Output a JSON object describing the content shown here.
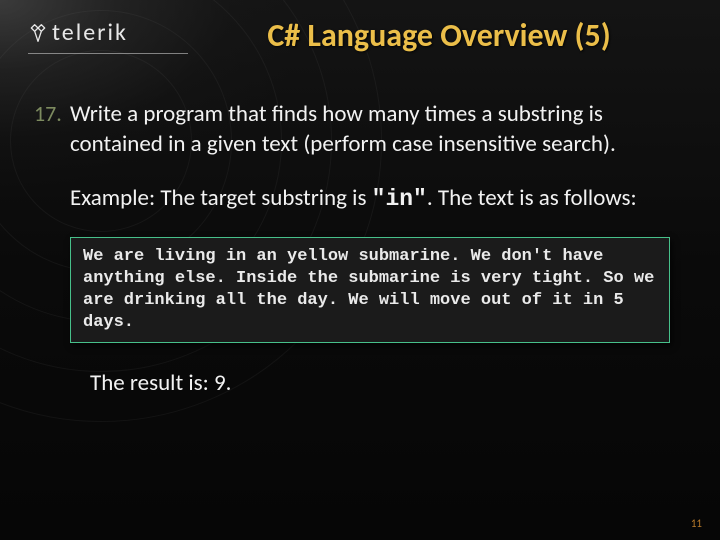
{
  "logo": {
    "brand_text": "telerik"
  },
  "title": "C# Language Overview (5)",
  "item": {
    "number": "17.",
    "text": "Write a program that finds how many times a substring is contained in a given text (perform case insensitive search)."
  },
  "example": {
    "lead_a": "Example: The target substring is ",
    "target_quoted": "\"in\"",
    "lead_b": ". The text is as follows:"
  },
  "code_text": "We are living in an yellow submarine. We don't have anything else. Inside the submarine is very tight. So we are drinking all the day. We will move out of it in 5 days.",
  "result_text": "The result is: 9.",
  "page_number": "11"
}
